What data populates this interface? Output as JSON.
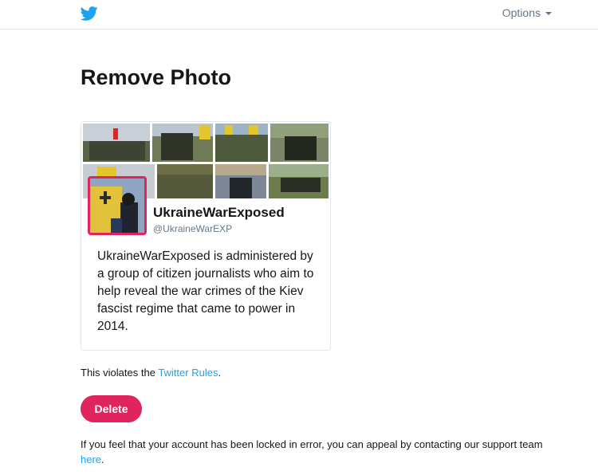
{
  "header": {
    "options_label": "Options",
    "colors": {
      "brand_blue": "#1da1f2",
      "muted": "#657786"
    }
  },
  "main": {
    "title": "Remove Photo"
  },
  "profile_card": {
    "display_name": "UkraineWarExposed",
    "handle": "@UkraineWarEXP",
    "bio": "UkraineWarExposed is administered by a group of citizen journalists who aim to help reveal the war crimes of the Kiev fascist regime that came to power in 2014.",
    "avatar_border_color": "#e0245e"
  },
  "violation": {
    "prefix": "This violates the ",
    "link_text": "Twitter Rules",
    "suffix": "."
  },
  "delete_button": {
    "label": "Delete",
    "color": "#e0245e"
  },
  "appeal": {
    "text": "If you feel that your account has been locked in error, you can appeal by contacting our support team ",
    "link_text": "here",
    "suffix": "."
  },
  "icons": {
    "logo": "twitter-bird-icon",
    "options": "chevron-down-icon"
  }
}
